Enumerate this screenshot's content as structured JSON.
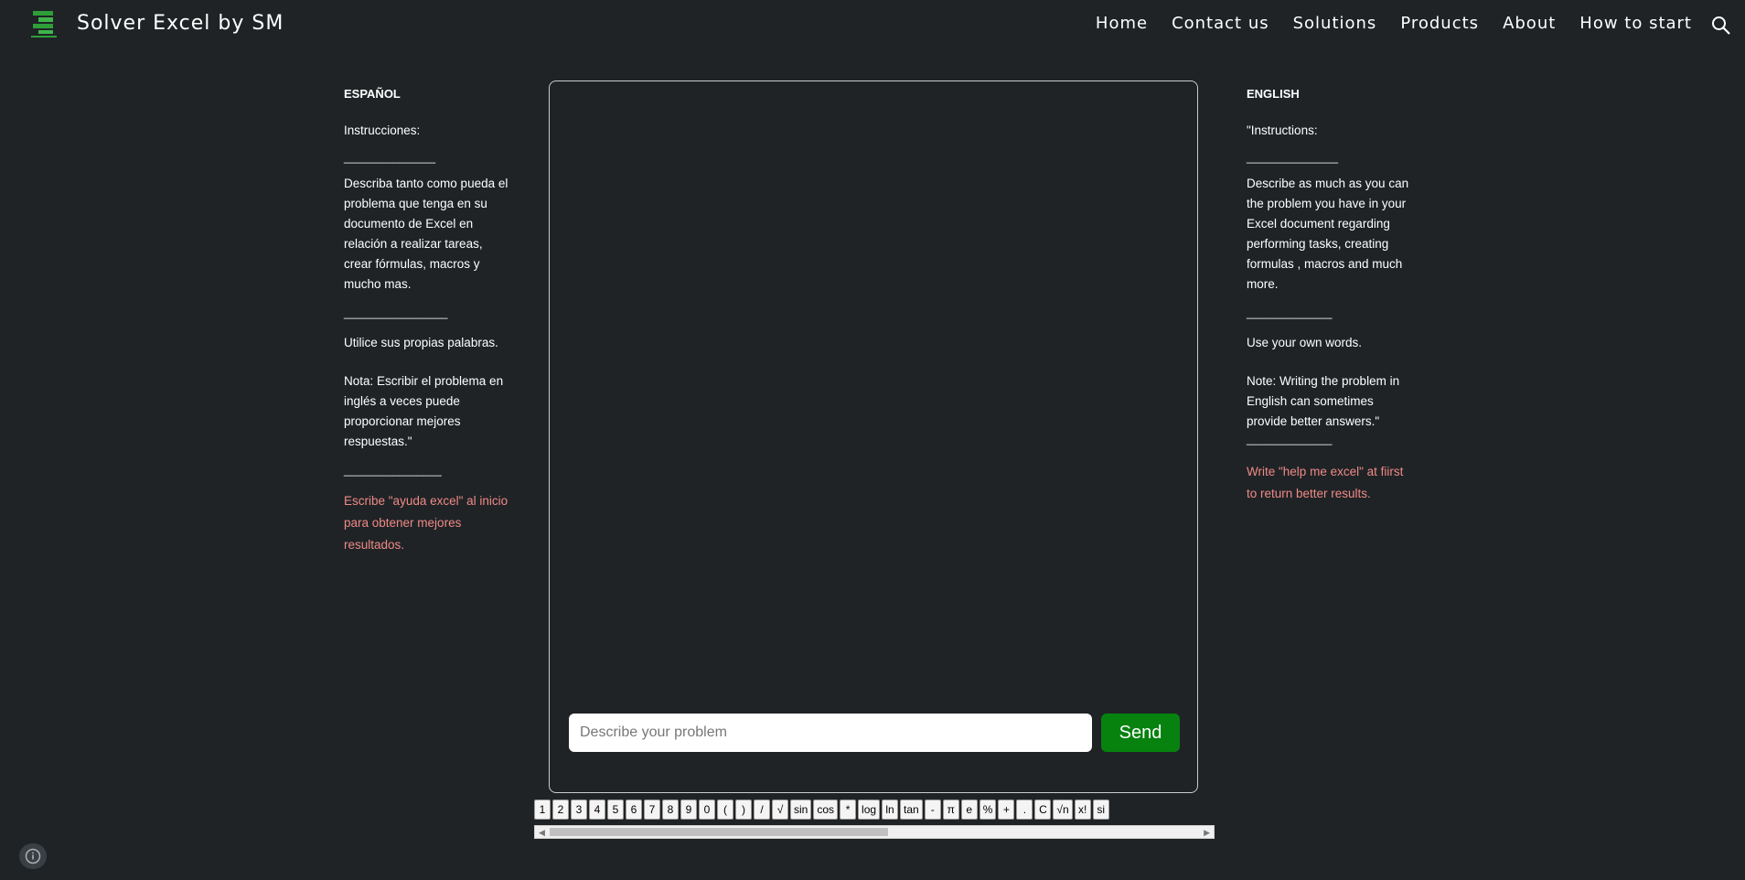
{
  "header": {
    "title": "Solver Excel by SM",
    "nav": [
      "Home",
      "Contact us",
      "Solutions",
      "Products",
      "About",
      "How to start"
    ],
    "search_icon": "search-icon",
    "logo_icon": "excel-logo"
  },
  "left_column": {
    "heading": "ESPAÑOL",
    "instructions_label": "Instrucciones:",
    "rule1": "_______________",
    "description": "Describa tanto como pueda el problema que tenga en su documento de Excel en relación a realizar tareas, crear fórmulas, macros y mucho mas.",
    "rule2": "_________________",
    "own_words": "Utilice sus propias palabras.",
    "note": "Nota: Escribir el problema en inglés a veces puede proporcionar mejores respuestas.\"",
    "rule3": "________________",
    "tip": "Escribe \"ayuda excel\" al inicio para obtener mejores resultados."
  },
  "right_column": {
    "heading": "ENGLISH",
    "instructions_label": "\"Instructions:",
    "rule1": "_______________",
    "description": "Describe as much as you can the problem you have in your Excel document regarding performing tasks, creating formulas , macros and much more.",
    "rule2": "______________",
    "own_words": "Use your own words.",
    "note": "Note: Writing the problem in English can sometimes provide better answers.\"",
    "rule3": "______________",
    "tip": "Write \"help me excel\" at fiirst to return better results."
  },
  "chat": {
    "input_placeholder": "Describe your problem",
    "input_value": "",
    "send_label": "Send"
  },
  "keypad": {
    "keys": [
      "1",
      "2",
      "3",
      "4",
      "5",
      "6",
      "7",
      "8",
      "9",
      "0",
      "(",
      ")",
      "/",
      "√",
      "sin",
      "cos",
      "*",
      "log",
      "ln",
      "tan",
      "-",
      "π",
      "e",
      "%",
      "+",
      ".",
      "C",
      "√n",
      "x!",
      "si"
    ]
  },
  "scrollbar": {
    "thumb_fraction_visible": 0.52,
    "position_fraction": 0.0
  },
  "colors": {
    "background": "#1f2326",
    "accent_red": "#f08a86",
    "send_green": "#07820f",
    "logo_green": "#2e9e38"
  },
  "info_icon": "info-icon"
}
